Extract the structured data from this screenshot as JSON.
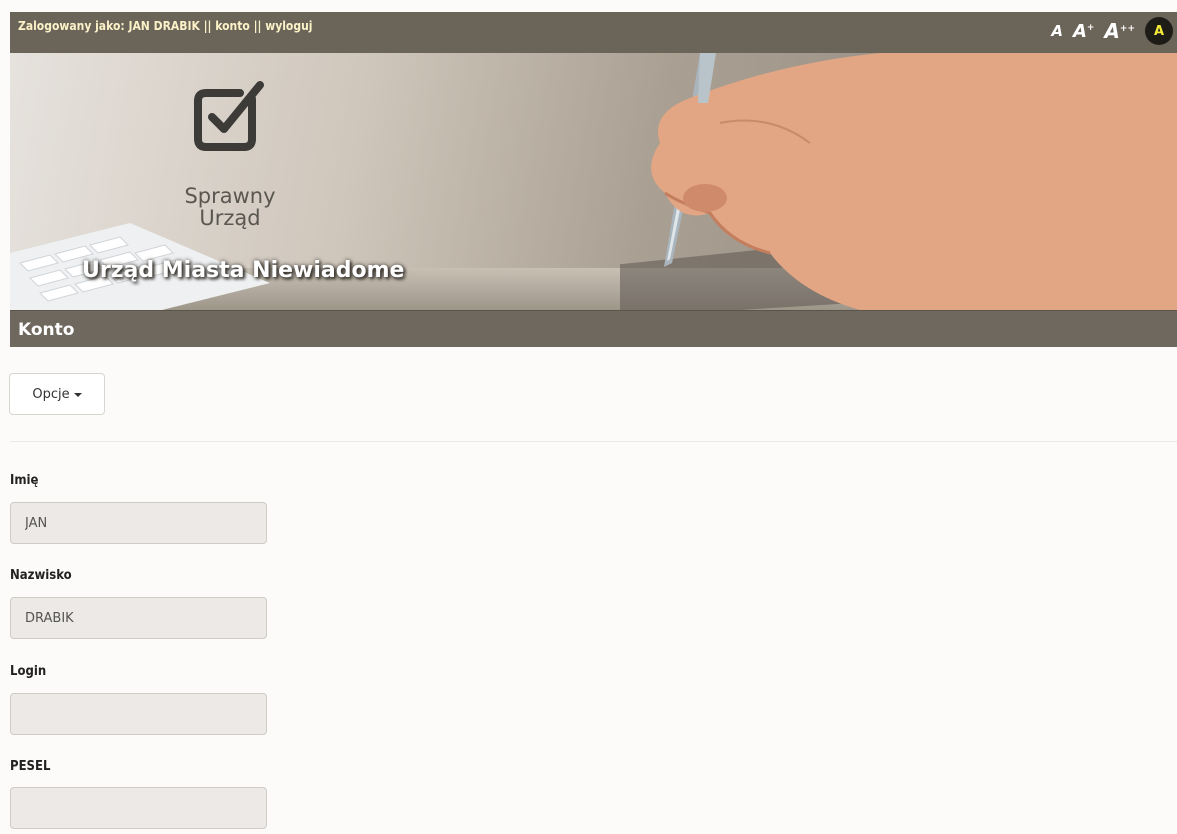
{
  "header": {
    "logged_as": "Zalogowany jako: JAN DRABIK ||",
    "account_link": "konto",
    "separator": "||",
    "logout_link": "wyloguj",
    "font_small": "A",
    "font_medium": "A",
    "font_medium_sup": "+",
    "font_large": "A",
    "font_large_sup": "++",
    "contrast": "A"
  },
  "banner": {
    "logo_line1": "Sprawny",
    "logo_line2": "Urząd",
    "city_name": "Urząd Miasta Niewiadome"
  },
  "page": {
    "title": "Konto",
    "options_label": "Opcje"
  },
  "form": {
    "first_name_label": "Imię",
    "first_name_value": "JAN",
    "last_name_label": "Nazwisko",
    "last_name_value": "DRABIK",
    "login_label": "Login",
    "login_value": "",
    "pesel_label": "PESEL",
    "pesel_value": ""
  },
  "colors": {
    "topbar": "#6b6459",
    "titlebar": "#6f685e",
    "header_text": "#fbf2c8",
    "contrast_fg": "#f3ea3a",
    "input_bg": "#ece9e6"
  }
}
